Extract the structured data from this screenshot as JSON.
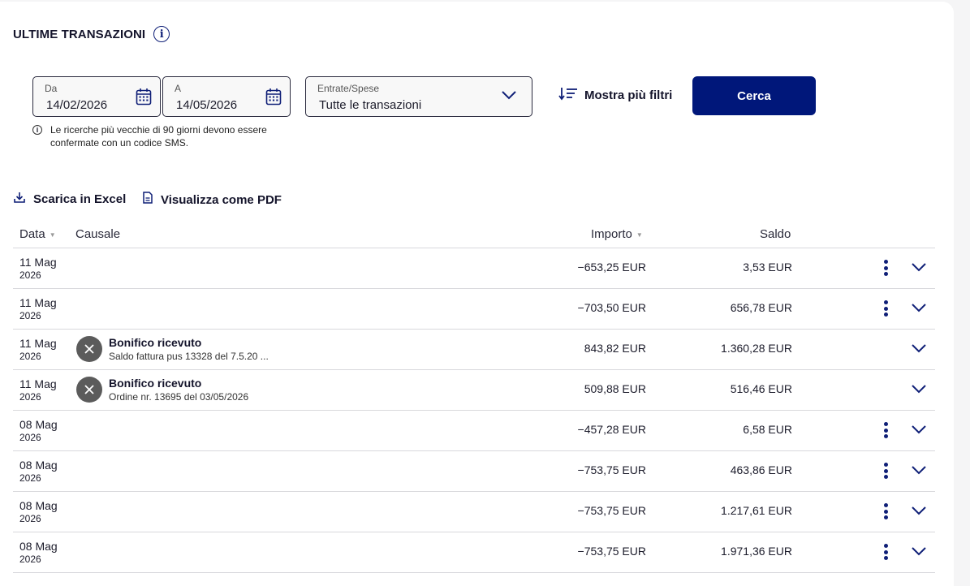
{
  "header": {
    "title": "ULTIME TRANSAZIONI",
    "info_icon": "info-icon"
  },
  "filters": {
    "from": {
      "label": "Da",
      "value": "14/02/2026"
    },
    "to": {
      "label": "A",
      "value": "14/05/2026"
    },
    "type": {
      "label": "Entrate/Spese",
      "value": "Tutte le transazioni"
    },
    "hint": "Le ricerche più vecchie di 90 giorni devono essere confermate con un codice SMS.",
    "more_filters": "Mostra più filtri",
    "search": "Cerca"
  },
  "actions": {
    "excel": "Scarica in Excel",
    "pdf": "Visualizza come PDF"
  },
  "table": {
    "headers": {
      "date": "Data",
      "description": "Causale",
      "amount": "Importo",
      "balance": "Saldo"
    },
    "rows": [
      {
        "day": "11 Mag",
        "year": "2026",
        "title": "",
        "subtitle": "",
        "amount": "−653,25 EUR",
        "balance": "3,53 EUR",
        "menu": true
      },
      {
        "day": "11 Mag",
        "year": "2026",
        "title": "",
        "subtitle": "",
        "amount": "−703,50 EUR",
        "balance": "656,78 EUR",
        "menu": true
      },
      {
        "day": "11 Mag",
        "year": "2026",
        "title": "Bonifico ricevuto",
        "subtitle": "Saldo fattura pus 13328 del 7.5.20 ...",
        "amount": "843,82 EUR",
        "balance": "1.360,28 EUR",
        "menu": false
      },
      {
        "day": "11 Mag",
        "year": "2026",
        "title": "Bonifico ricevuto",
        "subtitle": "Ordine nr. 13695 del 03/05/2026",
        "amount": "509,88 EUR",
        "balance": "516,46 EUR",
        "menu": false
      },
      {
        "day": "08 Mag",
        "year": "2026",
        "title": "",
        "subtitle": "",
        "amount": "−457,28 EUR",
        "balance": "6,58 EUR",
        "menu": true
      },
      {
        "day": "08 Mag",
        "year": "2026",
        "title": "",
        "subtitle": "",
        "amount": "−753,75 EUR",
        "balance": "463,86 EUR",
        "menu": true
      },
      {
        "day": "08 Mag",
        "year": "2026",
        "title": "",
        "subtitle": "",
        "amount": "−753,75 EUR",
        "balance": "1.217,61 EUR",
        "menu": true
      },
      {
        "day": "08 Mag",
        "year": "2026",
        "title": "",
        "subtitle": "",
        "amount": "−753,75 EUR",
        "balance": "1.971,36 EUR",
        "menu": true
      }
    ]
  },
  "colors": {
    "primary": "#00177a",
    "icon": "#0f1f77",
    "badge": "#5b5b5b"
  }
}
